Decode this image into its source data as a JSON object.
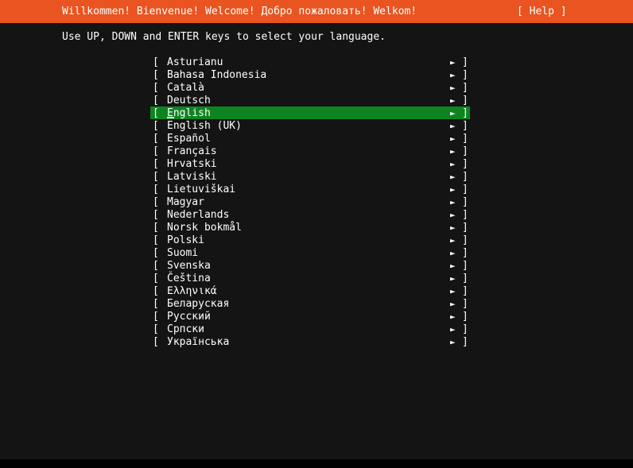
{
  "header": {
    "greeting": "Willkommen! Bienvenue! Welcome! Добро пожаловать! Welkom!",
    "help_label": "[ Help ]",
    "background_color": "#e95420",
    "text_color": "#ffffff"
  },
  "instruction": {
    "text": "Use UP, DOWN and ENTER keys to select your language."
  },
  "list": {
    "bracket_open": "[",
    "bracket_close": "]",
    "arrow_icon": "►",
    "selected_index": 4,
    "selected_background_color": "#0e8420",
    "items": [
      {
        "label": "Asturianu"
      },
      {
        "label": "Bahasa Indonesia"
      },
      {
        "label": "Català"
      },
      {
        "label": "Deutsch"
      },
      {
        "label": "English"
      },
      {
        "label": "English (UK)"
      },
      {
        "label": "Español"
      },
      {
        "label": "Français"
      },
      {
        "label": "Hrvatski"
      },
      {
        "label": "Latviski"
      },
      {
        "label": "Lietuviškai"
      },
      {
        "label": "Magyar"
      },
      {
        "label": "Nederlands"
      },
      {
        "label": "Norsk bokmål"
      },
      {
        "label": "Polski"
      },
      {
        "label": "Suomi"
      },
      {
        "label": "Svenska"
      },
      {
        "label": "Čeština"
      },
      {
        "label": "Ελληνικά"
      },
      {
        "label": "Беларуская"
      },
      {
        "label": "Русский"
      },
      {
        "label": "Српски"
      },
      {
        "label": "Українська"
      }
    ]
  },
  "screen": {
    "background_color": "#141414",
    "bottom_strip_color": "#000000"
  }
}
